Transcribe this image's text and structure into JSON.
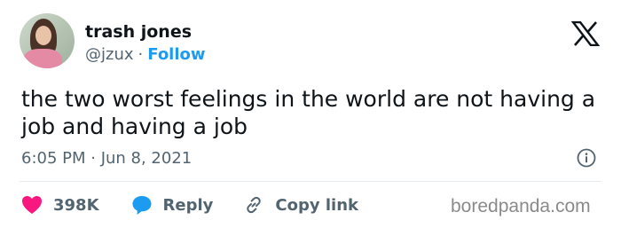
{
  "author": {
    "name": "trash jones",
    "handle": "@jzux",
    "separator": "·",
    "follow_label": "Follow"
  },
  "tweet": {
    "text": "the two worst feelings in the world are not having a job and having a job",
    "timestamp": "6:05 PM · Jun 8, 2021"
  },
  "actions": {
    "like_count": "398K",
    "reply_label": "Reply",
    "copy_link_label": "Copy link"
  },
  "icons": {
    "brand": "x-logo-icon",
    "info": "info-icon",
    "like": "heart-icon",
    "reply": "speech-bubble-icon",
    "copy": "link-icon"
  },
  "colors": {
    "follow": "#1d9bf0",
    "like": "#f91880",
    "reply": "#1d9bf0",
    "muted_text": "#536471",
    "primary_text": "#0f1419"
  },
  "watermark": "boredpanda.com"
}
